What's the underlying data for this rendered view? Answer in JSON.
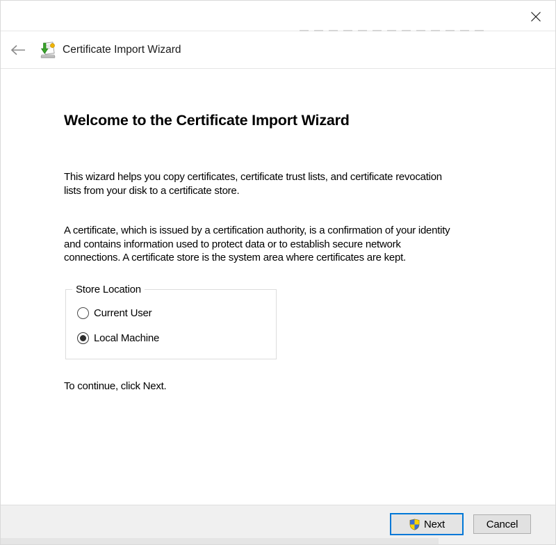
{
  "titlebar": {
    "close_icon": "close"
  },
  "header": {
    "title": "Certificate Import Wizard",
    "back_icon": "back-arrow",
    "app_icon": "certificate-import"
  },
  "content": {
    "heading": "Welcome to the Certificate Import Wizard",
    "para1": {
      "lines": [
        "This wizard helps you copy certificates, certificate trust lists, and certificate revocation",
        "lists from your disk to a certificate store."
      ]
    },
    "para2": {
      "lines": [
        "A certificate, which is issued by a certification authority, is a confirmation of your identity",
        "and contains information used to protect data or to establish secure network",
        "connections. A certificate store is the system area where certificates are kept."
      ]
    },
    "store_location": {
      "legend": "Store Location",
      "options": [
        {
          "label": "Current User",
          "selected": false
        },
        {
          "label": "Local Machine",
          "selected": true
        }
      ]
    },
    "hint": "To continue, click Next."
  },
  "footer": {
    "next_label": "Next",
    "cancel_label": "Cancel",
    "next_icon": "uac-shield"
  },
  "colors": {
    "accent_blue": "#0078d7",
    "footer_bg": "#f0f0f0",
    "button_face": "#e1e1e1",
    "shield_blue": "#3b6fd4",
    "shield_yellow": "#fbd500",
    "seal_yellow": "#f0b400",
    "arrow_green": "#3aa32a"
  }
}
